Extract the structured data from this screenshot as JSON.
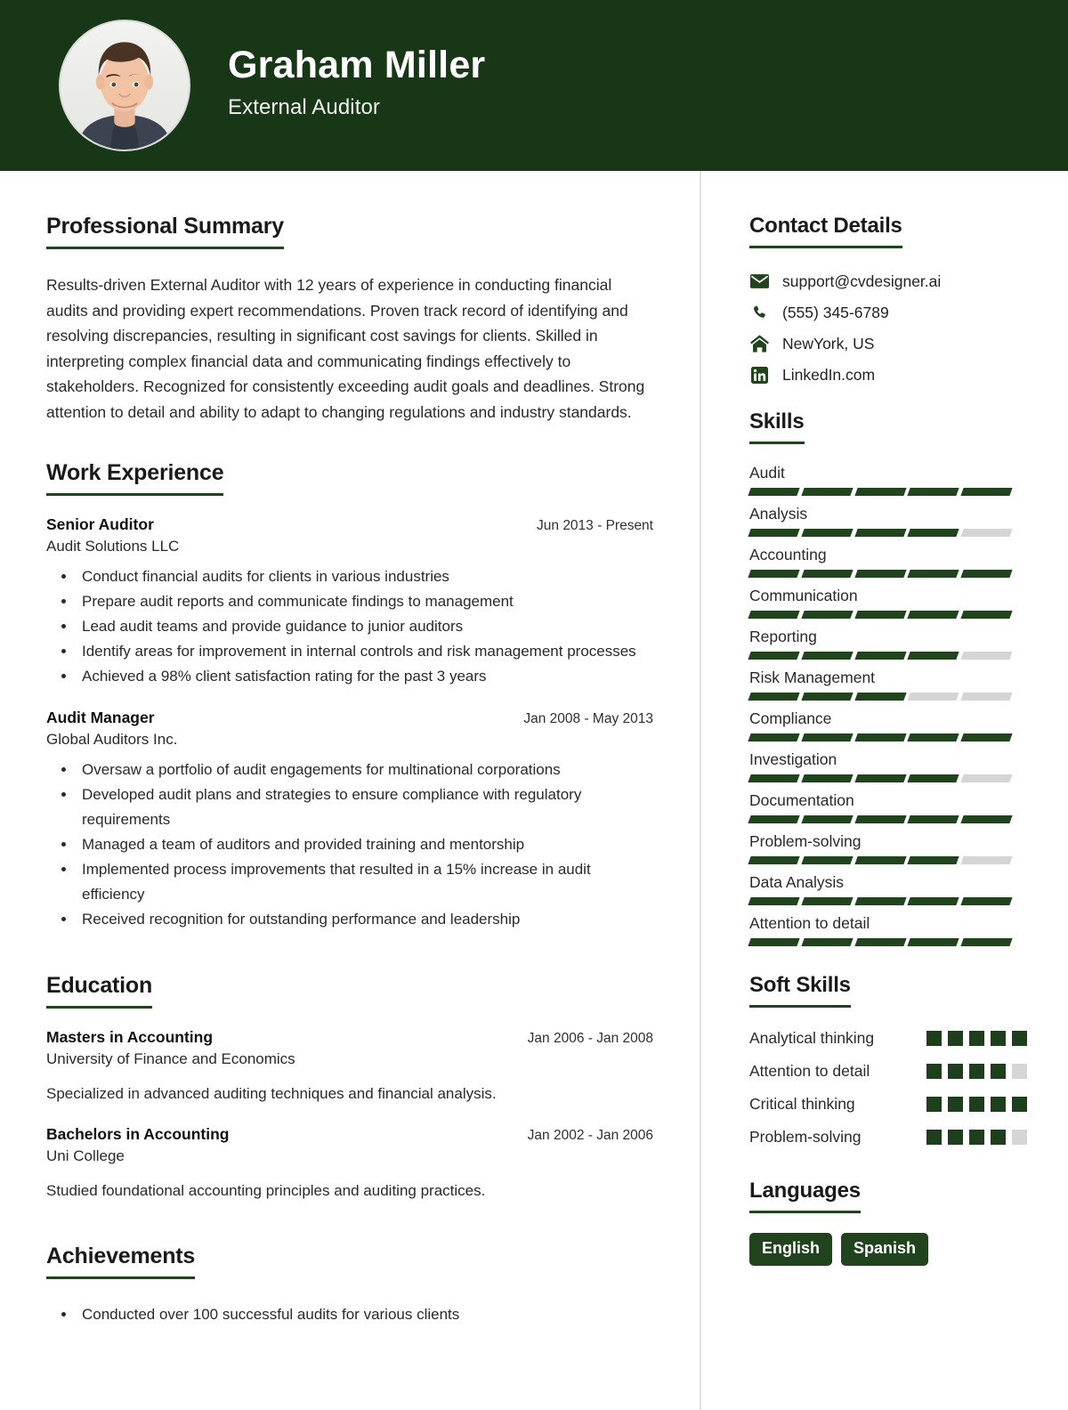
{
  "theme": {
    "primary": "#173717",
    "accent": "#21441f",
    "muted": "#d5d5d5",
    "text": "#2a2a2a"
  },
  "header": {
    "name": "Graham Miller",
    "job_title": "External Auditor",
    "avatar_alt": "profile-photo"
  },
  "left": {
    "summary": {
      "heading": "Professional Summary",
      "text": "Results-driven External Auditor with 12 years of experience in conducting financial audits and providing expert recommendations. Proven track record of identifying and resolving discrepancies, resulting in significant cost savings for clients. Skilled in interpreting complex financial data and communicating findings effectively to stakeholders. Recognized for consistently exceeding audit goals and deadlines. Strong attention to detail and ability to adapt to changing regulations and industry standards."
    },
    "experience": {
      "heading": "Work Experience",
      "entries": [
        {
          "role": "Senior Auditor",
          "date": "Jun 2013 - Present",
          "org": "Audit Solutions LLC",
          "bullets": [
            "Conduct financial audits for clients in various industries",
            "Prepare audit reports and communicate findings to management",
            "Lead audit teams and provide guidance to junior auditors",
            "Identify areas for improvement in internal controls and risk management processes",
            "Achieved a 98% client satisfaction rating for the past 3 years"
          ]
        },
        {
          "role": "Audit Manager",
          "date": "Jan 2008 - May 2013",
          "org": "Global Auditors Inc.",
          "bullets": [
            "Oversaw a portfolio of audit engagements for multinational corporations",
            "Developed audit plans and strategies to ensure compliance with regulatory requirements",
            "Managed a team of auditors and provided training and mentorship",
            "Implemented process improvements that resulted in a 15% increase in audit efficiency",
            "Received recognition for outstanding performance and leadership"
          ]
        }
      ]
    },
    "education": {
      "heading": "Education",
      "entries": [
        {
          "degree": "Masters in Accounting",
          "date": "Jan 2006 - Jan 2008",
          "school": "University of Finance and Economics",
          "description": "Specialized in advanced auditing techniques and financial analysis."
        },
        {
          "degree": "Bachelors in Accounting",
          "date": "Jan 2002 - Jan 2006",
          "school": "Uni College",
          "description": "Studied foundational accounting principles and auditing practices."
        }
      ]
    },
    "achievements": {
      "heading": "Achievements",
      "bullets": [
        "Conducted over 100 successful audits for various clients"
      ]
    }
  },
  "right": {
    "contact": {
      "heading": "Contact Details",
      "items": [
        {
          "icon": "envelope-icon",
          "value": "support@cvdesigner.ai"
        },
        {
          "icon": "phone-icon",
          "value": "(555) 345-6789"
        },
        {
          "icon": "home-icon",
          "value": "NewYork, US"
        },
        {
          "icon": "linkedin-icon",
          "value": "LinkedIn.com"
        }
      ]
    },
    "skills": {
      "heading": "Skills",
      "max": 5,
      "items": [
        {
          "name": "Audit",
          "level": 5
        },
        {
          "name": "Analysis",
          "level": 4
        },
        {
          "name": "Accounting",
          "level": 5
        },
        {
          "name": "Communication",
          "level": 5
        },
        {
          "name": "Reporting",
          "level": 4
        },
        {
          "name": "Risk Management",
          "level": 3
        },
        {
          "name": "Compliance",
          "level": 5
        },
        {
          "name": "Investigation",
          "level": 4
        },
        {
          "name": "Documentation",
          "level": 5
        },
        {
          "name": "Problem-solving",
          "level": 4
        },
        {
          "name": "Data Analysis",
          "level": 5
        },
        {
          "name": "Attention to detail",
          "level": 5
        }
      ]
    },
    "soft_skills": {
      "heading": "Soft Skills",
      "max": 5,
      "items": [
        {
          "name": "Analytical thinking",
          "level": 5
        },
        {
          "name": "Attention to detail",
          "level": 4
        },
        {
          "name": "Critical thinking",
          "level": 5
        },
        {
          "name": "Problem-solving",
          "level": 4
        }
      ]
    },
    "languages": {
      "heading": "Languages",
      "items": [
        "English",
        "Spanish"
      ]
    }
  }
}
